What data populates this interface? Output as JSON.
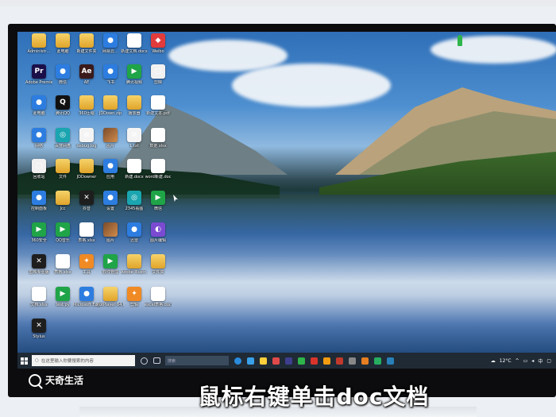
{
  "desktop": {
    "icons": [
      {
        "label": "Administr…",
        "type": "folder"
      },
      {
        "label": "此电脑",
        "type": "folder"
      },
      {
        "label": "新建文件夹",
        "type": "folder"
      },
      {
        "label": "网易云…",
        "type": "blue"
      },
      {
        "label": "新建文档.docx",
        "type": "doc"
      },
      {
        "label": "Weibo",
        "type": "red"
      },
      {
        "label": "Adobe Premie…",
        "type": "pr"
      },
      {
        "label": "微信",
        "type": "blue"
      },
      {
        "label": "AE",
        "type": "ae"
      },
      {
        "label": "飞书",
        "type": "blue"
      },
      {
        "label": "腾讯视频",
        "type": "green"
      },
      {
        "label": "剪映",
        "type": "white"
      },
      {
        "label": "此电脑",
        "type": "blue"
      },
      {
        "label": "腾讯QQ",
        "type": "qq"
      },
      {
        "label": "360压缩",
        "type": "folder"
      },
      {
        "label": "JDDown.zip",
        "type": "folder"
      },
      {
        "label": "播放器",
        "type": "folder"
      },
      {
        "label": "新建文本.pdf",
        "type": "pdf"
      },
      {
        "label": "网络",
        "type": "blue"
      },
      {
        "label": "百度网盘",
        "type": "teal"
      },
      {
        "label": "debug.log",
        "type": "txt"
      },
      {
        "label": "图片",
        "type": "pic"
      },
      {
        "label": "1.txt",
        "type": "txt"
      },
      {
        "label": "数据.xlsx",
        "type": "xls"
      },
      {
        "label": "回收站",
        "type": "white"
      },
      {
        "label": "文件",
        "type": "folder"
      },
      {
        "label": "JDDowner",
        "type": "folder"
      },
      {
        "label": "应用",
        "type": "blue"
      },
      {
        "label": "新建.docx",
        "type": "doc"
      },
      {
        "label": "word新建.doc",
        "type": "doc"
      },
      {
        "label": "控制面板",
        "type": "blue"
      },
      {
        "label": "Jcc",
        "type": "folder"
      },
      {
        "label": "抖音",
        "type": "dark"
      },
      {
        "label": "设置",
        "type": "blue"
      },
      {
        "label": "2345看图",
        "type": "teal"
      },
      {
        "label": "微信",
        "type": "green"
      },
      {
        "label": "360安全",
        "type": "green"
      },
      {
        "label": "QQ音乐",
        "type": "green"
      },
      {
        "label": "表格.xlsx",
        "type": "xls"
      },
      {
        "label": "图片",
        "type": "pic"
      },
      {
        "label": "迅雷",
        "type": "blue"
      },
      {
        "label": "图片编辑",
        "type": "purple"
      },
      {
        "label": "剪映专业版",
        "type": "dark"
      },
      {
        "label": "表格.xlsx",
        "type": "xls"
      },
      {
        "label": "工具",
        "type": "orange"
      },
      {
        "label": "软件管理",
        "type": "green"
      },
      {
        "label": "Adobe Illustr…",
        "type": "folder"
      },
      {
        "label": "文件夹",
        "type": "folder"
      },
      {
        "label": "文档.xlsx",
        "type": "xls"
      },
      {
        "label": "test.py",
        "type": "green"
      },
      {
        "label": "Microsoft Edge",
        "type": "blue"
      },
      {
        "label": "PotPlayer 64 bit",
        "type": "folder"
      },
      {
        "label": "剪辑",
        "type": "orange"
      },
      {
        "label": "excel表格.docx",
        "type": "doc"
      },
      {
        "label": "Stylus",
        "type": "dark"
      }
    ]
  },
  "taskbar": {
    "search_placeholder": "在这里输入你要搜索的内容",
    "search2_placeholder": "搜索",
    "weather": "12°C",
    "tray_text": "中"
  },
  "watermark": {
    "brand": "天奇生活"
  },
  "caption": {
    "text": "鼠标右键单击doc文档"
  }
}
